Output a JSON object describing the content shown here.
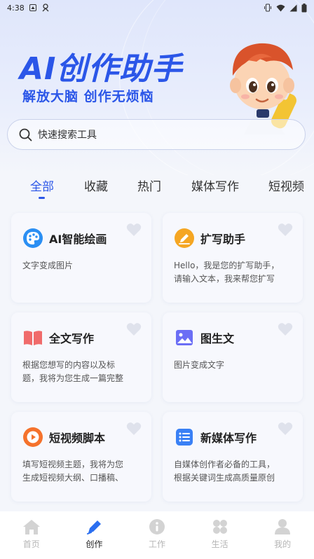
{
  "status_bar": {
    "time": "4:38"
  },
  "hero": {
    "title": "AI创作助手",
    "subtitle": "解放大脑  创作无烦恼"
  },
  "search": {
    "placeholder": "快速搜索工具"
  },
  "tabs": [
    {
      "label": "全部",
      "active": true
    },
    {
      "label": "收藏"
    },
    {
      "label": "热门"
    },
    {
      "label": "媒体写作"
    },
    {
      "label": "短视频"
    }
  ],
  "cards": [
    {
      "name": "AI智能绘画",
      "desc": "文字变成图片",
      "icon": "palette-icon",
      "color": "#2b8ff3"
    },
    {
      "name": "扩写助手",
      "desc": "Hello，我是您的扩写助手，\n请输入文本，我来帮您扩写",
      "icon": "pencil-icon",
      "color": "#f5a623"
    },
    {
      "name": "全文写作",
      "desc": "根据您想写的内容以及标\n题，我将为您生成一篇完整",
      "icon": "book-icon",
      "color": "#f06b6b"
    },
    {
      "name": "图生文",
      "desc": "图片变成文字",
      "icon": "image-icon",
      "color": "#6b6ef5"
    },
    {
      "name": "短视频脚本",
      "desc": "填写短视频主题，我将为您\n生成短视频大纲、口播稿、",
      "icon": "play-icon",
      "color": "#f5722c"
    },
    {
      "name": "新媒体写作",
      "desc": "自媒体创作者必备的工具，\n根据关键词生成高质量原创",
      "icon": "list-icon",
      "color": "#3a80f5"
    }
  ],
  "nav": [
    {
      "label": "首页",
      "icon": "home-icon"
    },
    {
      "label": "创作",
      "icon": "pen-icon",
      "active": true
    },
    {
      "label": "工作",
      "icon": "info-icon"
    },
    {
      "label": "生活",
      "icon": "grid-icon"
    },
    {
      "label": "我的",
      "icon": "user-icon"
    }
  ],
  "colors": {
    "accent": "#2b56e8",
    "heart": "#dfe2ec",
    "nav_inactive": "#b5b5b5"
  }
}
